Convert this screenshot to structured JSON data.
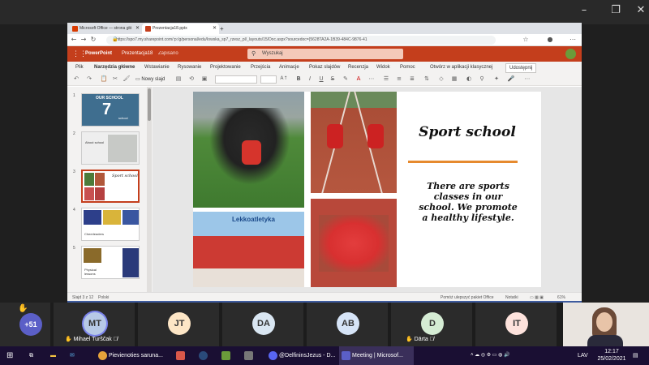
{
  "browser": {
    "tabs": [
      {
        "label": "Microsoft Office — strona głó",
        "icon_color": "#d83b01"
      },
      {
        "label": "Prezentacja18.pptx",
        "icon_color": "#c43e1c"
      }
    ],
    "url": "https://spo7.my.sharepoint.com/:p:/g/personal/edu/Iowska_sp7_rzesz_pl/_layouts/15/Doc.aspx?sourcedoc={5628TA2A-1B39-484C-9876-41"
  },
  "ppt": {
    "app_name": "PowerPoint",
    "doc_name": "Prezentacja18",
    "save_state": "Zapisano",
    "search_placeholder": "Wyszukaj",
    "menu": [
      "Plik",
      "Narzędzia główne",
      "Wstawianie",
      "Rysowanie",
      "Projektowanie",
      "Przejścia",
      "Animacje",
      "Pokaz slajdów",
      "Recenzja",
      "Widok",
      "Pomoc",
      "Otwórz w aplikacji klasycznej"
    ],
    "share": "Udostępnij",
    "new_slide": "Nowy slajd",
    "thumb_numbers": [
      "1",
      "2",
      "3",
      "4",
      "5"
    ],
    "thumb1_title": "OUR SCHOOL",
    "thumb1_num": "7",
    "thumb1_sub": "school",
    "thumb2_title": "About school",
    "thumb3_title": "Sport school",
    "thumb4_caption": "Cheerleaders",
    "thumb5_caption": "Physical lessons",
    "slide": {
      "title": "Sport school",
      "body": "There are sports classes in our school. We promote a healthy lifestyle.",
      "banner": "Lekkoatletyka",
      "accent": "#e68a2e"
    },
    "status": {
      "slide_count": "Slajd 3 z 12",
      "language": "Polski",
      "help": "Pomóż ulepszyć pakiet Office",
      "notes": "Notatki",
      "zoom": "61%"
    }
  },
  "meeting": {
    "more_count": "+51",
    "participants": [
      {
        "initials": "MT",
        "name": "Mihael Turščak",
        "color": "#b7c9e6"
      },
      {
        "initials": "JT",
        "name": "",
        "color": "#fde6c6"
      },
      {
        "initials": "DA",
        "name": "",
        "color": "#d9e6f2"
      },
      {
        "initials": "AB",
        "name": "",
        "color": "#d6e4f7"
      },
      {
        "initials": "D",
        "name": "Dārta",
        "color": "#d5ecd4"
      },
      {
        "initials": "IT",
        "name": "",
        "color": "#fde2dc"
      }
    ]
  },
  "taskbar": {
    "items": [
      "Pievienoties saruna...",
      "@DelfininsJezus - D...",
      "Meeting | Microsof..."
    ],
    "lang": "LAV",
    "time": "12:17",
    "date": "25/02/2021"
  }
}
